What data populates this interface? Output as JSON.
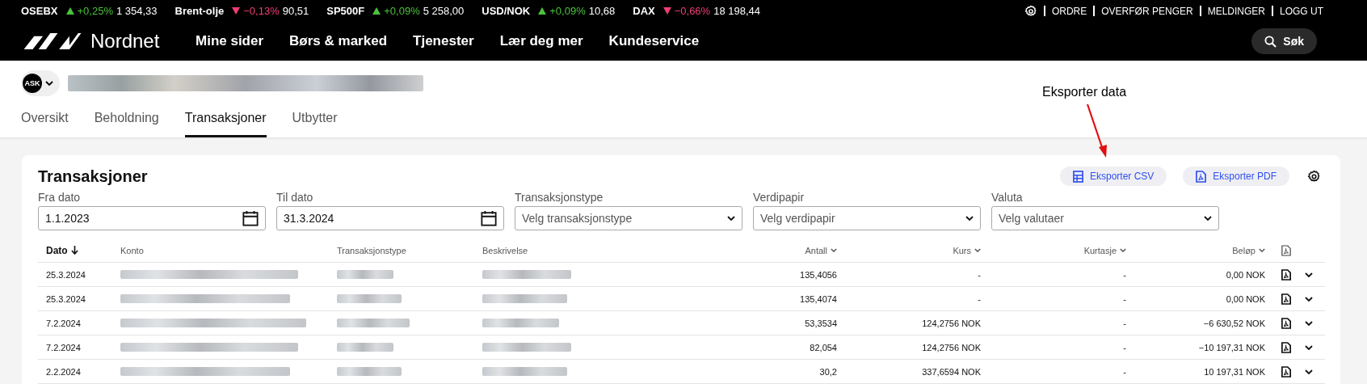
{
  "ticker": [
    {
      "name": "OSEBX",
      "kind": "up",
      "change": "+0,25%",
      "value": "1 354,33"
    },
    {
      "name": "Brent-olje",
      "kind": "down",
      "change": "−0,13%",
      "value": "90,51"
    },
    {
      "name": "SP500F",
      "kind": "up",
      "change": "+0,09%",
      "value": "5 258,00"
    },
    {
      "name": "USD/NOK",
      "kind": "up",
      "change": "+0,09%",
      "value": "10,68"
    },
    {
      "name": "DAX",
      "kind": "down",
      "change": "−0,66%",
      "value": "18 198,44"
    }
  ],
  "top_links": [
    "ORDRE",
    "OVERFØR PENGER",
    "MELDINGER",
    "LOGG UT"
  ],
  "brand": "Nordnet",
  "nav": [
    "Mine sider",
    "Børs & marked",
    "Tjenester",
    "Lær deg mer",
    "Kundeservice"
  ],
  "search_button": "Søk",
  "account_badge": "ASK",
  "tabs": [
    {
      "label": "Oversikt",
      "selected": false
    },
    {
      "label": "Beholdning",
      "selected": false
    },
    {
      "label": "Transaksjoner",
      "selected": true
    },
    {
      "label": "Utbytter",
      "selected": false
    }
  ],
  "annotation": "Eksporter data",
  "card": {
    "title": "Transaksjoner",
    "export_buttons": [
      {
        "label": "Eksporter CSV",
        "kind": "csv"
      },
      {
        "label": "Eksporter PDF",
        "kind": "pdf"
      }
    ],
    "filters": [
      {
        "label": "Fra dato",
        "kind": "date",
        "value": "1.1.2023"
      },
      {
        "label": "Til dato",
        "kind": "date",
        "value": "31.3.2024"
      },
      {
        "label": "Transaksjonstype",
        "kind": "select",
        "placeholder": "Velg transaksjonstype"
      },
      {
        "label": "Verdipapir",
        "kind": "select",
        "placeholder": "Velg verdipapir"
      },
      {
        "label": "Valuta",
        "kind": "select",
        "placeholder": "Velg valutaer"
      }
    ],
    "columns": [
      {
        "label": "Dato",
        "kind": "arrow",
        "sorted": true
      },
      {
        "label": "Konto",
        "sorted": false
      },
      {
        "label": "Transaksjonstype",
        "sorted": false
      },
      {
        "label": "Beskrivelse",
        "sorted": false
      },
      {
        "label": "Antall",
        "kind": "chevron",
        "sorted": false
      },
      {
        "label": "Kurs",
        "kind": "chevron",
        "sorted": false
      },
      {
        "label": "Kurtasje",
        "kind": "chevron",
        "sorted": false
      },
      {
        "label": "Beløp",
        "kind": "chevron",
        "sorted": false
      }
    ],
    "rows": [
      {
        "date": "25.3.2024",
        "antall": "135,4056",
        "kurs": "-",
        "kurtasje": "-",
        "belop": "0,00 NOK"
      },
      {
        "date": "25.3.2024",
        "antall": "135,4074",
        "kurs": "-",
        "kurtasje": "-",
        "belop": "0,00 NOK"
      },
      {
        "date": "7.2.2024",
        "antall": "53,3534",
        "kurs": "124,2756 NOK",
        "kurtasje": "-",
        "belop": "−6 630,52 NOK"
      },
      {
        "date": "7.2.2024",
        "antall": "82,054",
        "kurs": "124,2756 NOK",
        "kurtasje": "-",
        "belop": "−10 197,31 NOK"
      },
      {
        "date": "2.2.2024",
        "antall": "30,2",
        "kurs": "337,6594 NOK",
        "kurtasje": "-",
        "belop": "10 197,31 NOK"
      }
    ]
  }
}
